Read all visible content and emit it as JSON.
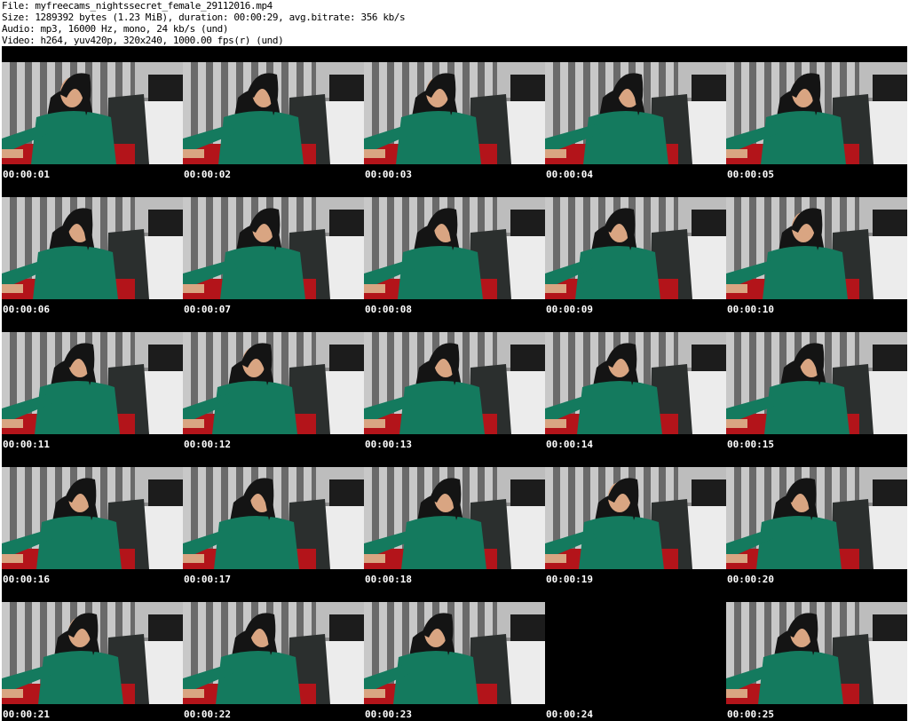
{
  "header": {
    "file": "File: myfreecams_nightssecret_female_29112016.mp4",
    "size": "Size: 1289392 bytes (1.23 MiB), duration: 00:00:29, avg.bitrate: 356 kb/s",
    "audio": "Audio: mp3, 16000 Hz, mono, 24 kb/s (und)",
    "video": "Video: h264, yuv420p, 320x240, 1000.00 fps(r) (und)"
  },
  "thumbnails": [
    {
      "timestamp": "00:00:01",
      "blank": false
    },
    {
      "timestamp": "00:00:02",
      "blank": false
    },
    {
      "timestamp": "00:00:03",
      "blank": false
    },
    {
      "timestamp": "00:00:04",
      "blank": false
    },
    {
      "timestamp": "00:00:05",
      "blank": false
    },
    {
      "timestamp": "00:00:06",
      "blank": false
    },
    {
      "timestamp": "00:00:07",
      "blank": false
    },
    {
      "timestamp": "00:00:08",
      "blank": false
    },
    {
      "timestamp": "00:00:09",
      "blank": false
    },
    {
      "timestamp": "00:00:10",
      "blank": false
    },
    {
      "timestamp": "00:00:11",
      "blank": false
    },
    {
      "timestamp": "00:00:12",
      "blank": false
    },
    {
      "timestamp": "00:00:13",
      "blank": false
    },
    {
      "timestamp": "00:00:14",
      "blank": false
    },
    {
      "timestamp": "00:00:15",
      "blank": false
    },
    {
      "timestamp": "00:00:16",
      "blank": false
    },
    {
      "timestamp": "00:00:17",
      "blank": false
    },
    {
      "timestamp": "00:00:18",
      "blank": false
    },
    {
      "timestamp": "00:00:19",
      "blank": false
    },
    {
      "timestamp": "00:00:20",
      "blank": false
    },
    {
      "timestamp": "00:00:21",
      "blank": false
    },
    {
      "timestamp": "00:00:22",
      "blank": false
    },
    {
      "timestamp": "00:00:23",
      "blank": false
    },
    {
      "timestamp": "00:00:24",
      "blank": true
    },
    {
      "timestamp": "00:00:25",
      "blank": false
    }
  ],
  "colors": {
    "sheet_background": "#000000",
    "timestamp_text": "#ffffff",
    "curtain_light": "#c8c8c8",
    "curtain_dark": "#6a6a6a",
    "sweater": "#147a5e",
    "hair": "#141414",
    "skin": "#d9a582",
    "floor_red": "#b3141a",
    "bed_white": "#ececec",
    "chair_dark": "#2b2f2e"
  }
}
